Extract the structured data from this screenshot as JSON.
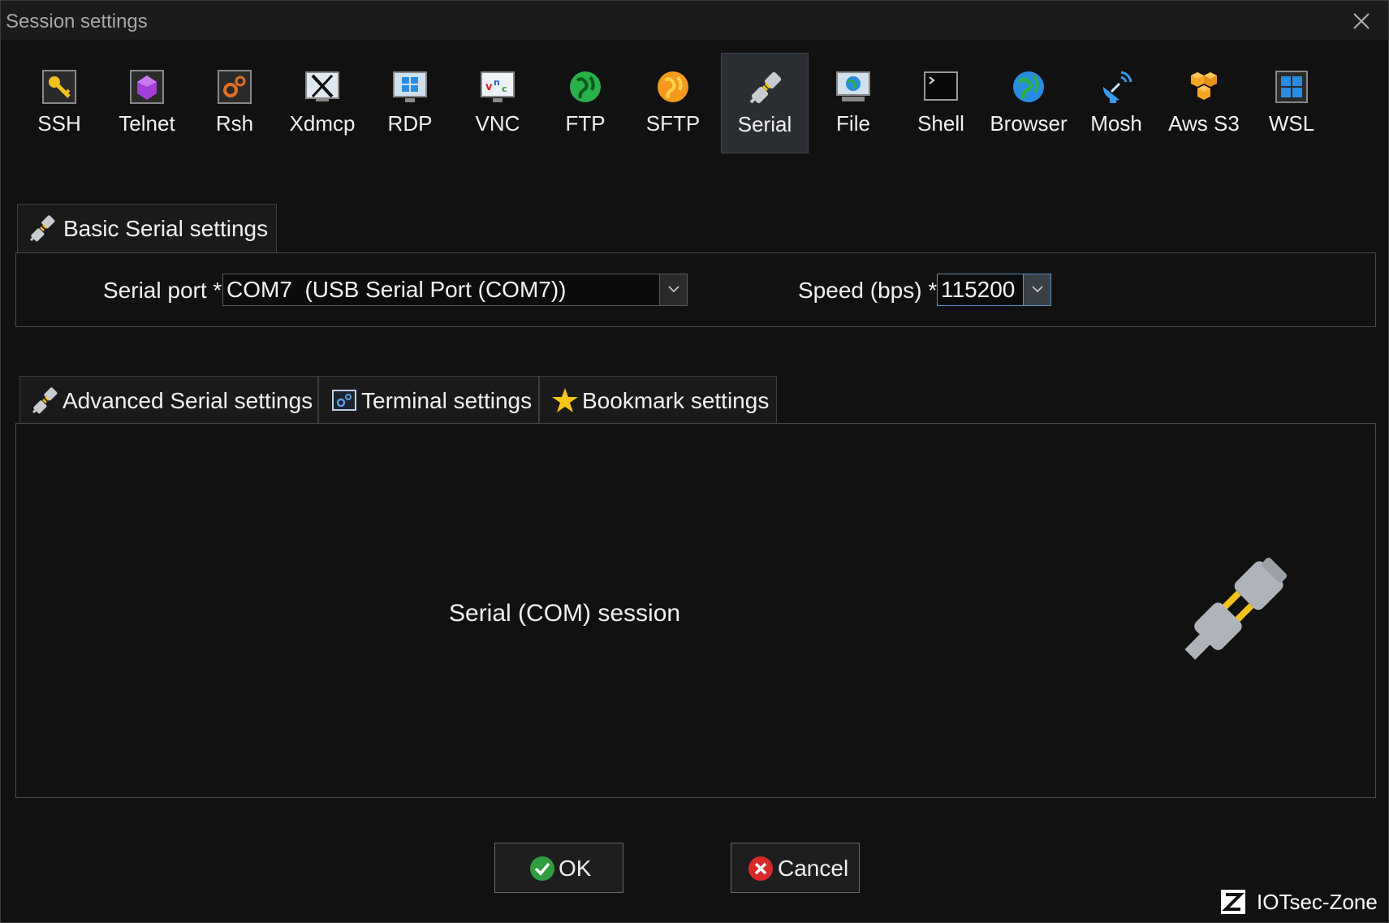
{
  "window": {
    "title": "Session settings"
  },
  "session_types": [
    {
      "label": "SSH",
      "icon": "key-icon",
      "selected": false
    },
    {
      "label": "Telnet",
      "icon": "telnet-gem-icon",
      "selected": false
    },
    {
      "label": "Rsh",
      "icon": "gears-icon",
      "selected": false
    },
    {
      "label": "Xdmcp",
      "icon": "x-window-icon",
      "selected": false
    },
    {
      "label": "RDP",
      "icon": "windows-monitor-icon",
      "selected": false
    },
    {
      "label": "VNC",
      "icon": "vnc-monitor-icon",
      "selected": false
    },
    {
      "label": "FTP",
      "icon": "green-globe-icon",
      "selected": false
    },
    {
      "label": "SFTP",
      "icon": "orange-globe-icon",
      "selected": false
    },
    {
      "label": "Serial",
      "icon": "serial-plug-icon",
      "selected": true
    },
    {
      "label": "File",
      "icon": "file-monitor-icon",
      "selected": false
    },
    {
      "label": "Shell",
      "icon": "terminal-icon",
      "selected": false
    },
    {
      "label": "Browser",
      "icon": "blue-globe-icon",
      "selected": false
    },
    {
      "label": "Mosh",
      "icon": "satellite-dish-icon",
      "selected": false
    },
    {
      "label": "Aws S3",
      "icon": "cubes-icon",
      "selected": false
    },
    {
      "label": "WSL",
      "icon": "windows-logo-icon",
      "selected": false
    }
  ],
  "basic": {
    "tab_label": "Basic Serial settings",
    "serial_port_label": "Serial port *",
    "serial_port_value": "COM7  (USB Serial Port (COM7))",
    "speed_label": "Speed (bps) *",
    "speed_value": "115200"
  },
  "advanced_tabs": [
    {
      "label": "Advanced Serial settings",
      "icon": "serial-plug-icon"
    },
    {
      "label": "Terminal settings",
      "icon": "terminal-settings-icon"
    },
    {
      "label": "Bookmark settings",
      "icon": "star-icon"
    }
  ],
  "content": {
    "session_text": "Serial (COM) session"
  },
  "buttons": {
    "ok_label": "OK",
    "cancel_label": "Cancel"
  },
  "watermark": {
    "text": "IOTsec-Zone"
  },
  "colors": {
    "selected_bg": "#2a2e33",
    "accent_focus": "#5a8fbf",
    "ok_green": "#2e9e3e",
    "cancel_red": "#d92a2a"
  }
}
